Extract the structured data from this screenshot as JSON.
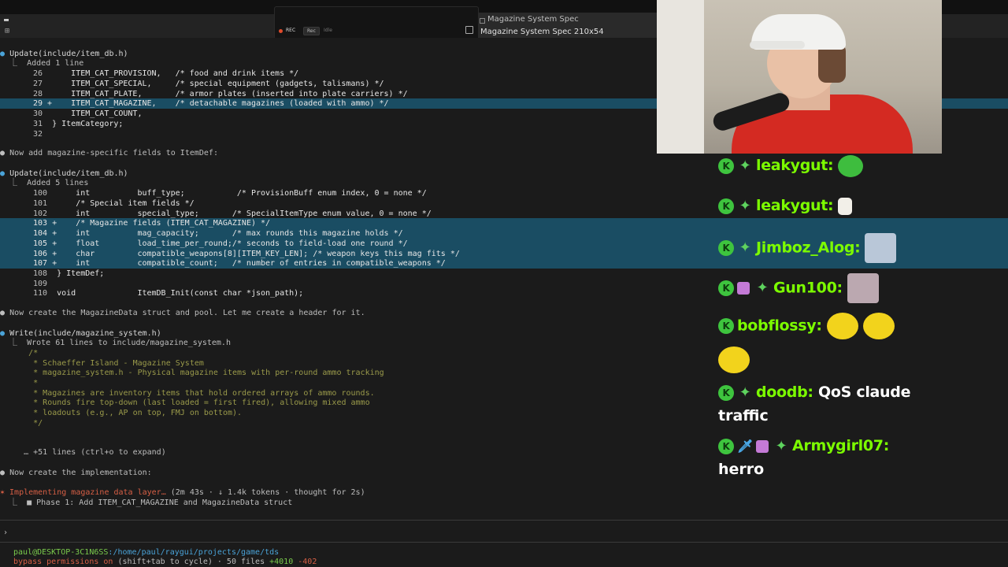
{
  "overlay": {
    "rec_label": "REC",
    "chips": [
      "Rec",
      "Idle"
    ],
    "spec_window_title": "Magazine System Spec",
    "spec_window_subtitle": "Magazine System Spec 210x54"
  },
  "terminal": {
    "lines": [
      {
        "bullet": "●",
        "tool": "Update(include/item_db.h)"
      },
      {
        "text": "  ⎿  Added 1 line"
      },
      {
        "num": "26",
        "code": "      ITEM_CAT_PROVISION,   ",
        "cmt": "/* food and drink items */"
      },
      {
        "num": "27",
        "code": "      ITEM_CAT_SPECIAL,     ",
        "cmt": "/* special equipment (gadgets, talismans) */"
      },
      {
        "num": "28",
        "code": "      ITEM_CAT_PLATE,       ",
        "cmt": "/* armor plates (inserted into plate carriers) */"
      },
      {
        "num": "29 +",
        "code": "    ITEM_CAT_MAGAZINE,    ",
        "cmt": "/* detachable magazines (loaded with ammo) */"
      },
      {
        "num": "30",
        "code": "      ITEM_CAT_COUNT,",
        "cmt": ""
      },
      {
        "num": "31",
        "code": "  } ItemCategory;",
        "cmt": ""
      },
      {
        "num": "32",
        "code": "",
        "cmt": ""
      },
      {
        "bullet": "●",
        "text": "Now add magazine-specific fields to ItemDef:"
      },
      {
        "bullet": "●",
        "tool": "Update(include/item_db.h)"
      },
      {
        "text": "  ⎿  Added 5 lines"
      },
      {
        "num": "100",
        "code": "      int          buff_type;           ",
        "cmt": "/* ProvisionBuff enum index, 0 = none */"
      },
      {
        "num": "101",
        "code": "      ",
        "cmt": "/* Special item fields */"
      },
      {
        "num": "102",
        "code": "      int          special_type;       ",
        "cmt": "/* SpecialItemType enum value, 0 = none */"
      },
      {
        "num": "103 +",
        "code": "    ",
        "cmt": "/* Magazine fields (ITEM_CAT_MAGAZINE) */"
      },
      {
        "num": "104 +",
        "code": "    int          mag_capacity;       ",
        "cmt": "/* max rounds this magazine holds */"
      },
      {
        "num": "105 +",
        "code": "    float        load_time_per_round;",
        "cmt": "/* seconds to field-load one round */"
      },
      {
        "num": "106 +",
        "code": "    char         compatible_weapons[8][ITEM_KEY_LEN]; ",
        "cmt": "/* weapon keys this mag fits */"
      },
      {
        "num": "107 +",
        "code": "    int          compatible_count;   ",
        "cmt": "/* number of entries in compatible_weapons */"
      },
      {
        "num": "108",
        "code": "  } ItemDef;",
        "cmt": ""
      },
      {
        "num": "109",
        "code": "",
        "cmt": ""
      },
      {
        "num": "110",
        "code": "  void             ItemDB_Init(const char *json_path);",
        "cmt": ""
      },
      {
        "bullet": "●",
        "text": "Now create the MagazineData struct and pool. Let me create a header for it."
      },
      {
        "bullet": "●",
        "tool": "Write(include/magazine_system.h)"
      },
      {
        "text": "  ⎿  Wrote 61 lines to include/magazine_system.h"
      },
      {
        "cmt": "      /*"
      },
      {
        "cmt": "       * Schaeffer Island - Magazine System"
      },
      {
        "cmt": "       * magazine_system.h - Physical magazine items with per-round ammo tracking"
      },
      {
        "cmt": "       *"
      },
      {
        "cmt": "       * Magazines are inventory items that hold ordered arrays of ammo rounds."
      },
      {
        "cmt": "       * Rounds fire top-down (last loaded = first fired), allowing mixed ammo"
      },
      {
        "cmt": "       * loadouts (e.g., AP on top, FMJ on bottom)."
      },
      {
        "cmt": "       */"
      },
      {
        "text": "     … +51 lines (ctrl+o to expand)"
      },
      {
        "bullet": "●",
        "text": "Now create the implementation:"
      },
      {
        "orange": "✶ Implementing magazine data layer… ",
        "text": "(2m 43s · ↓ 1.4k tokens · thought for 2s)"
      },
      {
        "text": "  ⎿  ■ Phase 1: Add ITEM_CAT_MAGAZINE and MagazineData struct"
      }
    ],
    "prompt_symbol": "›",
    "status_user": "paul@DESKTOP-3C1N6SS",
    "status_path": ":/home/paul/raygui/projects/game/tds",
    "status_line2_a": "bypass permissions on",
    "status_line2_b": " (shift+tab to cycle) · 50 files ",
    "status_line2_c": "+4010",
    "status_line2_d": " -402"
  },
  "chat": {
    "messages": [
      {
        "user": "leakygut:",
        "text": ""
      },
      {
        "user": "leakygut:",
        "text": ""
      },
      {
        "user": "Jimboz_Alog:",
        "text": ""
      },
      {
        "user": "Gun100:",
        "text": ""
      },
      {
        "user": "bobflossy:",
        "text": ""
      },
      {
        "user": "doodb:",
        "text": "QoS claude",
        "text2": "traffic"
      },
      {
        "user": "Armygirl07:",
        "text": "",
        "text2": "herro"
      }
    ]
  },
  "colors": {
    "highlight": "#1a4d63",
    "username": "#7CFC00",
    "accent_orange": "#d75f45"
  }
}
